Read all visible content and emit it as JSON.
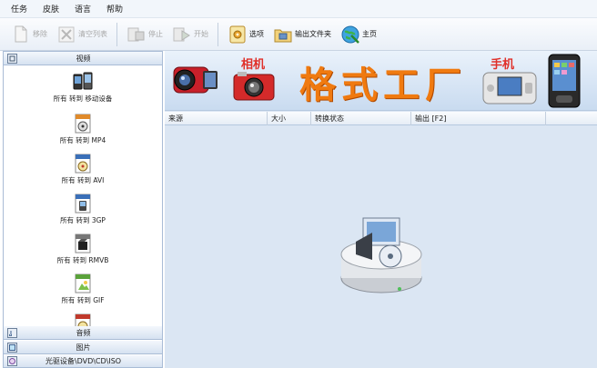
{
  "menu": [
    "任务",
    "皮肤",
    "语言",
    "帮助"
  ],
  "toolbar": {
    "remove": "移除",
    "clear_list": "清空列表",
    "stop": "停止",
    "start": "开始",
    "options": "选项",
    "output_folder": "输出文件夹",
    "home": "主页"
  },
  "sidebar": {
    "video_header": "视频",
    "entries": [
      "所有 转到 移动设备",
      "所有 转到 MP4",
      "所有 转到 AVI",
      "所有 转到 3GP",
      "所有 转到 RMVB",
      "所有 转到 GIF"
    ],
    "audio_header": "音频",
    "image_header": "图片",
    "rom_header": "光驱设备\\DVD\\CD\\ISO"
  },
  "banner": {
    "title": "格式工厂",
    "camera_label": "相机",
    "phone_label": "手机"
  },
  "table": {
    "columns": [
      "来源",
      "大小",
      "转换状态",
      "输出 [F2]"
    ]
  },
  "colors": {
    "accent_orange": "#f07a10",
    "label_red": "#e0302a",
    "panel_blue": "#dbe6f3"
  }
}
